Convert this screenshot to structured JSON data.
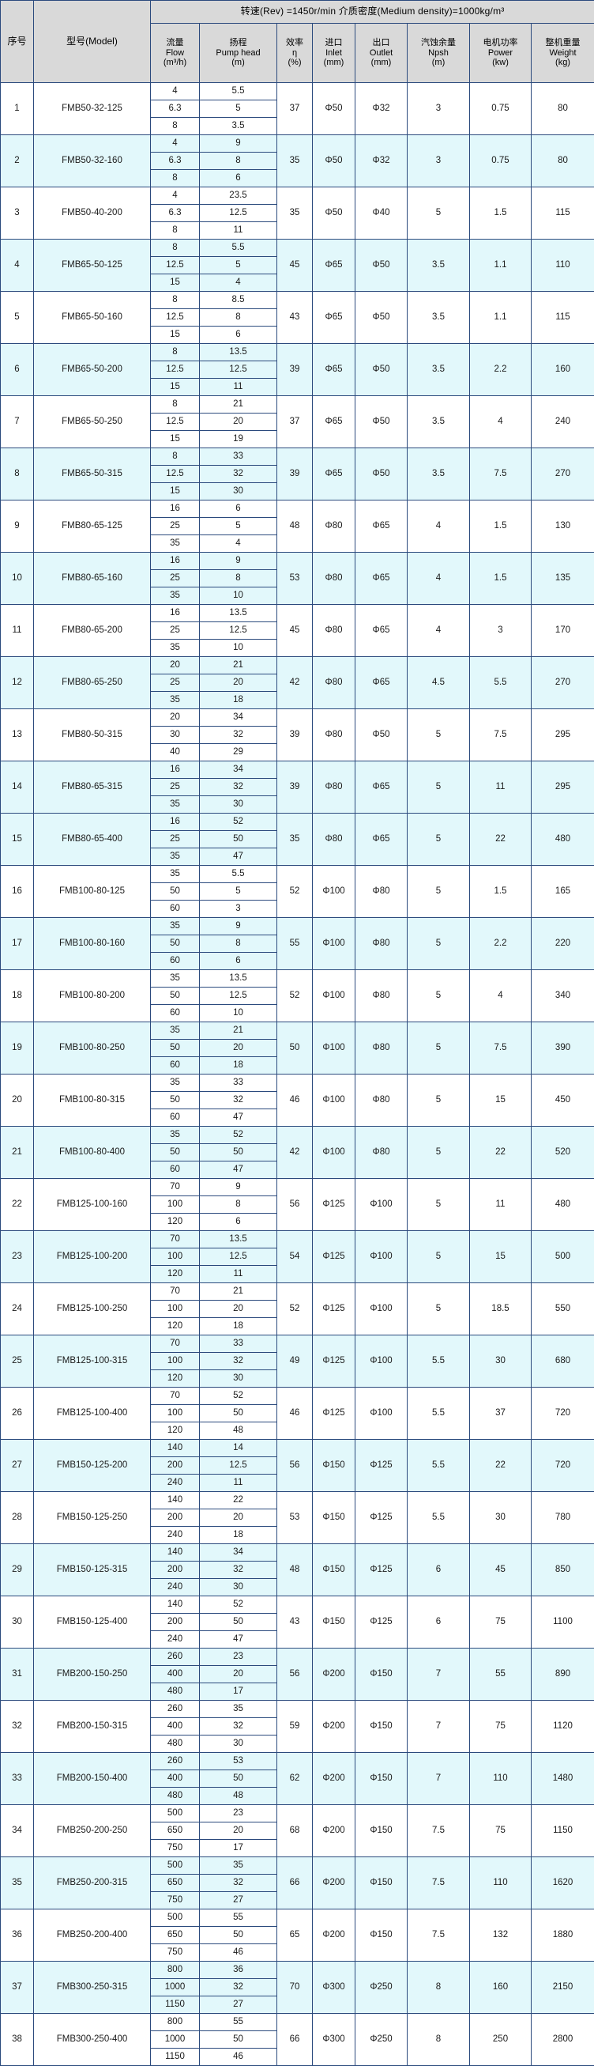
{
  "header": {
    "banner": "转速(Rev) =1450r/min   介质密度(Medium density)=1000kg/m³",
    "col_index": "序号",
    "col_model": "型号(Model)",
    "col_flow": [
      "流量",
      "Flow",
      "(m³/h)"
    ],
    "col_head": [
      "扬程",
      "Pump head",
      "(m)"
    ],
    "col_eff": [
      "效率",
      "η",
      "(%)"
    ],
    "col_inlet": [
      "进口",
      "Inlet",
      "(mm)"
    ],
    "col_outlet": [
      "出口",
      "Outlet",
      "(mm)"
    ],
    "col_npsh": [
      "汽蚀余量",
      "Npsh",
      "(m)"
    ],
    "col_power": [
      "电机功率",
      "Power",
      "(kw)"
    ],
    "col_weight": [
      "整机重量",
      "Weight",
      "(kg)"
    ]
  },
  "colors": {
    "band": "#e2f8fb",
    "header_bg": "#d9d9d9",
    "border": "#2b4a7d",
    "text": "#1a1a1a"
  },
  "rows": [
    {
      "idx": "1",
      "model": "FMB50-32-125",
      "flow": [
        "4",
        "6.3",
        "8"
      ],
      "head": [
        "5.5",
        "5",
        "3.5"
      ],
      "eff": "37",
      "inlet": "Φ50",
      "outlet": "Φ32",
      "npsh": "3",
      "power": "0.75",
      "weight": "80",
      "band": false
    },
    {
      "idx": "2",
      "model": "FMB50-32-160",
      "flow": [
        "4",
        "6.3",
        "8"
      ],
      "head": [
        "9",
        "8",
        "6"
      ],
      "eff": "35",
      "inlet": "Φ50",
      "outlet": "Φ32",
      "npsh": "3",
      "power": "0.75",
      "weight": "80",
      "band": true
    },
    {
      "idx": "3",
      "model": "FMB50-40-200",
      "flow": [
        "4",
        "6.3",
        "8"
      ],
      "head": [
        "23.5",
        "12.5",
        "11"
      ],
      "eff": "35",
      "inlet": "Φ50",
      "outlet": "Φ40",
      "npsh": "5",
      "power": "1.5",
      "weight": "115",
      "band": false
    },
    {
      "idx": "4",
      "model": "FMB65-50-125",
      "flow": [
        "8",
        "12.5",
        "15"
      ],
      "head": [
        "5.5",
        "5",
        "4"
      ],
      "eff": "45",
      "inlet": "Φ65",
      "outlet": "Φ50",
      "npsh": "3.5",
      "power": "1.1",
      "weight": "110",
      "band": true
    },
    {
      "idx": "5",
      "model": "FMB65-50-160",
      "flow": [
        "8",
        "12.5",
        "15"
      ],
      "head": [
        "8.5",
        "8",
        "6"
      ],
      "eff": "43",
      "inlet": "Φ65",
      "outlet": "Φ50",
      "npsh": "3.5",
      "power": "1.1",
      "weight": "115",
      "band": false
    },
    {
      "idx": "6",
      "model": "FMB65-50-200",
      "flow": [
        "8",
        "12.5",
        "15"
      ],
      "head": [
        "13.5",
        "12.5",
        "11"
      ],
      "eff": "39",
      "inlet": "Φ65",
      "outlet": "Φ50",
      "npsh": "3.5",
      "power": "2.2",
      "weight": "160",
      "band": true
    },
    {
      "idx": "7",
      "model": "FMB65-50-250",
      "flow": [
        "8",
        "12.5",
        "15"
      ],
      "head": [
        "21",
        "20",
        "19"
      ],
      "eff": "37",
      "inlet": "Φ65",
      "outlet": "Φ50",
      "npsh": "3.5",
      "power": "4",
      "weight": "240",
      "band": false
    },
    {
      "idx": "8",
      "model": "FMB65-50-315",
      "flow": [
        "8",
        "12.5",
        "15"
      ],
      "head": [
        "33",
        "32",
        "30"
      ],
      "eff": "39",
      "inlet": "Φ65",
      "outlet": "Φ50",
      "npsh": "3.5",
      "power": "7.5",
      "weight": "270",
      "band": true
    },
    {
      "idx": "9",
      "model": "FMB80-65-125",
      "flow": [
        "16",
        "25",
        "35"
      ],
      "head": [
        "6",
        "5",
        "4"
      ],
      "eff": "48",
      "inlet": "Φ80",
      "outlet": "Φ65",
      "npsh": "4",
      "power": "1.5",
      "weight": "130",
      "band": false
    },
    {
      "idx": "10",
      "model": "FMB80-65-160",
      "flow": [
        "16",
        "25",
        "35"
      ],
      "head": [
        "9",
        "8",
        "10"
      ],
      "eff": "53",
      "inlet": "Φ80",
      "outlet": "Φ65",
      "npsh": "4",
      "power": "1.5",
      "weight": "135",
      "band": true
    },
    {
      "idx": "11",
      "model": "FMB80-65-200",
      "flow": [
        "16",
        "25",
        "35"
      ],
      "head": [
        "13.5",
        "12.5",
        "10"
      ],
      "eff": "45",
      "inlet": "Φ80",
      "outlet": "Φ65",
      "npsh": "4",
      "power": "3",
      "weight": "170",
      "band": false
    },
    {
      "idx": "12",
      "model": "FMB80-65-250",
      "flow": [
        "20",
        "25",
        "35"
      ],
      "head": [
        "21",
        "20",
        "18"
      ],
      "eff": "42",
      "inlet": "Φ80",
      "outlet": "Φ65",
      "npsh": "4.5",
      "power": "5.5",
      "weight": "270",
      "band": true
    },
    {
      "idx": "13",
      "model": "FMB80-50-315",
      "flow": [
        "20",
        "30",
        "40"
      ],
      "head": [
        "34",
        "32",
        "29"
      ],
      "eff": "39",
      "inlet": "Φ80",
      "outlet": "Φ50",
      "npsh": "5",
      "power": "7.5",
      "weight": "295",
      "band": false
    },
    {
      "idx": "14",
      "model": "FMB80-65-315",
      "flow": [
        "16",
        "25",
        "35"
      ],
      "head": [
        "34",
        "32",
        "30"
      ],
      "eff": "39",
      "inlet": "Φ80",
      "outlet": "Φ65",
      "npsh": "5",
      "power": "11",
      "weight": "295",
      "band": true
    },
    {
      "idx": "15",
      "model": "FMB80-65-400",
      "flow": [
        "16",
        "25",
        "35"
      ],
      "head": [
        "52",
        "50",
        "47"
      ],
      "eff": "35",
      "inlet": "Φ80",
      "outlet": "Φ65",
      "npsh": "5",
      "power": "22",
      "weight": "480",
      "band": true
    },
    {
      "idx": "16",
      "model": "FMB100-80-125",
      "flow": [
        "35",
        "50",
        "60"
      ],
      "head": [
        "5.5",
        "5",
        "3"
      ],
      "eff": "52",
      "inlet": "Φ100",
      "outlet": "Φ80",
      "npsh": "5",
      "power": "1.5",
      "weight": "165",
      "band": false
    },
    {
      "idx": "17",
      "model": "FMB100-80-160",
      "flow": [
        "35",
        "50",
        "60"
      ],
      "head": [
        "9",
        "8",
        "6"
      ],
      "eff": "55",
      "inlet": "Φ100",
      "outlet": "Φ80",
      "npsh": "5",
      "power": "2.2",
      "weight": "220",
      "band": true
    },
    {
      "idx": "18",
      "model": "FMB100-80-200",
      "flow": [
        "35",
        "50",
        "60"
      ],
      "head": [
        "13.5",
        "12.5",
        "10"
      ],
      "eff": "52",
      "inlet": "Φ100",
      "outlet": "Φ80",
      "npsh": "5",
      "power": "4",
      "weight": "340",
      "band": false
    },
    {
      "idx": "19",
      "model": "FMB100-80-250",
      "flow": [
        "35",
        "50",
        "60"
      ],
      "head": [
        "21",
        "20",
        "18"
      ],
      "eff": "50",
      "inlet": "Φ100",
      "outlet": "Φ80",
      "npsh": "5",
      "power": "7.5",
      "weight": "390",
      "band": true
    },
    {
      "idx": "20",
      "model": "FMB100-80-315",
      "flow": [
        "35",
        "50",
        "60"
      ],
      "head": [
        "33",
        "32",
        "47"
      ],
      "eff": "46",
      "inlet": "Φ100",
      "outlet": "Φ80",
      "npsh": "5",
      "power": "15",
      "weight": "450",
      "band": false
    },
    {
      "idx": "21",
      "model": "FMB100-80-400",
      "flow": [
        "35",
        "50",
        "60"
      ],
      "head": [
        "52",
        "50",
        "47"
      ],
      "eff": "42",
      "inlet": "Φ100",
      "outlet": "Φ80",
      "npsh": "5",
      "power": "22",
      "weight": "520",
      "band": true
    },
    {
      "idx": "22",
      "model": "FMB125-100-160",
      "flow": [
        "70",
        "100",
        "120"
      ],
      "head": [
        "9",
        "8",
        "6"
      ],
      "eff": "56",
      "inlet": "Φ125",
      "outlet": "Φ100",
      "npsh": "5",
      "power": "11",
      "weight": "480",
      "band": false
    },
    {
      "idx": "23",
      "model": "FMB125-100-200",
      "flow": [
        "70",
        "100",
        "120"
      ],
      "head": [
        "13.5",
        "12.5",
        "11"
      ],
      "eff": "54",
      "inlet": "Φ125",
      "outlet": "Φ100",
      "npsh": "5",
      "power": "15",
      "weight": "500",
      "band": true
    },
    {
      "idx": "24",
      "model": "FMB125-100-250",
      "flow": [
        "70",
        "100",
        "120"
      ],
      "head": [
        "21",
        "20",
        "18"
      ],
      "eff": "52",
      "inlet": "Φ125",
      "outlet": "Φ100",
      "npsh": "5",
      "power": "18.5",
      "weight": "550",
      "band": false
    },
    {
      "idx": "25",
      "model": "FMB125-100-315",
      "flow": [
        "70",
        "100",
        "120"
      ],
      "head": [
        "33",
        "32",
        "30"
      ],
      "eff": "49",
      "inlet": "Φ125",
      "outlet": "Φ100",
      "npsh": "5.5",
      "power": "30",
      "weight": "680",
      "band": true
    },
    {
      "idx": "26",
      "model": "FMB125-100-400",
      "flow": [
        "70",
        "100",
        "120"
      ],
      "head": [
        "52",
        "50",
        "48"
      ],
      "eff": "46",
      "inlet": "Φ125",
      "outlet": "Φ100",
      "npsh": "5.5",
      "power": "37",
      "weight": "720",
      "band": false
    },
    {
      "idx": "27",
      "model": "FMB150-125-200",
      "flow": [
        "140",
        "200",
        "240"
      ],
      "head": [
        "14",
        "12.5",
        "11"
      ],
      "eff": "56",
      "inlet": "Φ150",
      "outlet": "Φ125",
      "npsh": "5.5",
      "power": "22",
      "weight": "720",
      "band": true
    },
    {
      "idx": "28",
      "model": "FMB150-125-250",
      "flow": [
        "140",
        "200",
        "240"
      ],
      "head": [
        "22",
        "20",
        "18"
      ],
      "eff": "53",
      "inlet": "Φ150",
      "outlet": "Φ125",
      "npsh": "5.5",
      "power": "30",
      "weight": "780",
      "band": false
    },
    {
      "idx": "29",
      "model": "FMB150-125-315",
      "flow": [
        "140",
        "200",
        "240"
      ],
      "head": [
        "34",
        "32",
        "30"
      ],
      "eff": "48",
      "inlet": "Φ150",
      "outlet": "Φ125",
      "npsh": "6",
      "power": "45",
      "weight": "850",
      "band": true
    },
    {
      "idx": "30",
      "model": "FMB150-125-400",
      "flow": [
        "140",
        "200",
        "240"
      ],
      "head": [
        "52",
        "50",
        "47"
      ],
      "eff": "43",
      "inlet": "Φ150",
      "outlet": "Φ125",
      "npsh": "6",
      "power": "75",
      "weight": "1100",
      "band": false
    },
    {
      "idx": "31",
      "model": "FMB200-150-250",
      "flow": [
        "260",
        "400",
        "480"
      ],
      "head": [
        "23",
        "20",
        "17"
      ],
      "eff": "56",
      "inlet": "Φ200",
      "outlet": "Φ150",
      "npsh": "7",
      "power": "55",
      "weight": "890",
      "band": true
    },
    {
      "idx": "32",
      "model": "FMB200-150-315",
      "flow": [
        "260",
        "400",
        "480"
      ],
      "head": [
        "35",
        "32",
        "30"
      ],
      "eff": "59",
      "inlet": "Φ200",
      "outlet": "Φ150",
      "npsh": "7",
      "power": "75",
      "weight": "1120",
      "band": false
    },
    {
      "idx": "33",
      "model": "FMB200-150-400",
      "flow": [
        "260",
        "400",
        "480"
      ],
      "head": [
        "53",
        "50",
        "48"
      ],
      "eff": "62",
      "inlet": "Φ200",
      "outlet": "Φ150",
      "npsh": "7",
      "power": "110",
      "weight": "1480",
      "band": true
    },
    {
      "idx": "34",
      "model": "FMB250-200-250",
      "flow": [
        "500",
        "650",
        "750"
      ],
      "head": [
        "23",
        "20",
        "17"
      ],
      "eff": "68",
      "inlet": "Φ200",
      "outlet": "Φ150",
      "npsh": "7.5",
      "power": "75",
      "weight": "1150",
      "band": false
    },
    {
      "idx": "35",
      "model": "FMB250-200-315",
      "flow": [
        "500",
        "650",
        "750"
      ],
      "head": [
        "35",
        "32",
        "27"
      ],
      "eff": "66",
      "inlet": "Φ200",
      "outlet": "Φ150",
      "npsh": "7.5",
      "power": "110",
      "weight": "1620",
      "band": true
    },
    {
      "idx": "36",
      "model": "FMB250-200-400",
      "flow": [
        "500",
        "650",
        "750"
      ],
      "head": [
        "55",
        "50",
        "46"
      ],
      "eff": "65",
      "inlet": "Φ200",
      "outlet": "Φ150",
      "npsh": "7.5",
      "power": "132",
      "weight": "1880",
      "band": false
    },
    {
      "idx": "37",
      "model": "FMB300-250-315",
      "flow": [
        "800",
        "1000",
        "1150"
      ],
      "head": [
        "36",
        "32",
        "27"
      ],
      "eff": "70",
      "inlet": "Φ300",
      "outlet": "Φ250",
      "npsh": "8",
      "power": "160",
      "weight": "2150",
      "band": true
    },
    {
      "idx": "38",
      "model": "FMB300-250-400",
      "flow": [
        "800",
        "1000",
        "1150"
      ],
      "head": [
        "55",
        "50",
        "46"
      ],
      "eff": "66",
      "inlet": "Φ300",
      "outlet": "Φ250",
      "npsh": "8",
      "power": "250",
      "weight": "2800",
      "band": false
    }
  ]
}
